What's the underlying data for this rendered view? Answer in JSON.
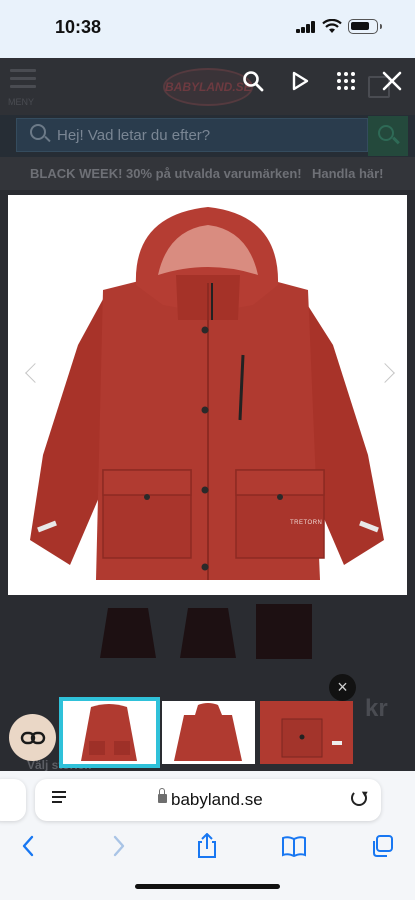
{
  "status_bar": {
    "time": "10:38"
  },
  "header": {
    "menu_label": "MENY",
    "logo_text": "BABYLAND.SE"
  },
  "search": {
    "placeholder": "Hej! Vad letar du efter?"
  },
  "promo": {
    "text": "BLACK WEEK! 30% på utvalda varumärken!",
    "link": "Handla här!"
  },
  "product": {
    "brand_label": "TRETORN",
    "price_fragment": "kr",
    "size_label": "Välj storlek"
  },
  "overlay": {
    "close_small": "×"
  },
  "browser": {
    "url": "babyland.se"
  },
  "colors": {
    "accent": "#2fc1d9",
    "jacket": "#b03a30",
    "safari_blue": "#1877f2"
  }
}
